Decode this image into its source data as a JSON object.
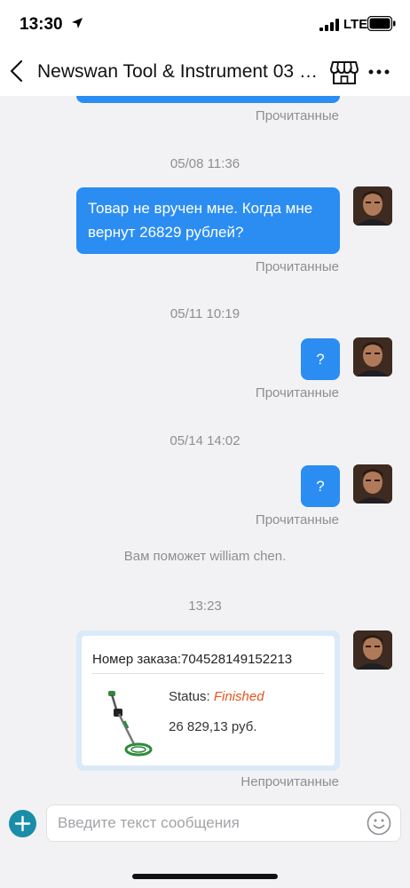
{
  "status_bar": {
    "time": "13:30",
    "network": "LTE"
  },
  "header": {
    "title": "Newswan Tool & Instrument 03 S...",
    "back_icon": "chevron-left-icon",
    "store_icon": "store-icon",
    "more_icon": "ellipsis-icon"
  },
  "messages": {
    "read_label_1": "Прочитанные",
    "time_1": "05/08 11:36",
    "text_1_line1": "Товар не вручен мне. Когда мне",
    "text_1_line2": "вернут 26829 рублей?",
    "read_label_2": "Прочитанные",
    "time_2": "05/11 10:19",
    "text_2": "?",
    "read_label_3": "Прочитанные",
    "time_3": "05/14 14:02",
    "text_3": "?",
    "read_label_4": "Прочитанные",
    "system_note": "Вам поможет william chen.",
    "time_4": "13:23",
    "unread_label": "Непрочитанные"
  },
  "order_card": {
    "order_number": "Номер заказа:704528149152213",
    "status_label": "Status: ",
    "status_value": "Finished",
    "price": "26 829,13 руб."
  },
  "composer": {
    "placeholder": "Введите текст сообщения",
    "add_icon": "plus-icon",
    "emoji_icon": "smiley-icon"
  },
  "colors": {
    "bubble": "#2b8df2",
    "status_finished": "#e8541e",
    "add_button": "#1a8ea8"
  }
}
